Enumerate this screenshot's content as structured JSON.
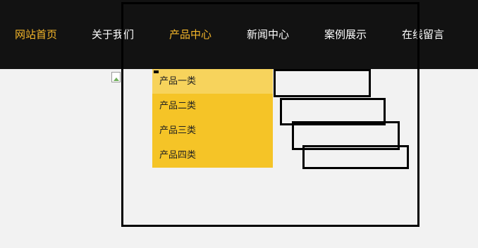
{
  "nav": {
    "items": [
      {
        "label": "网站首页",
        "active": true
      },
      {
        "label": "关于我们",
        "active": false
      },
      {
        "label": "产品中心",
        "active": true
      },
      {
        "label": "新闻中心",
        "active": false
      },
      {
        "label": "案例展示",
        "active": false
      },
      {
        "label": "在线留言",
        "active": false
      }
    ]
  },
  "dropdown": {
    "items": [
      {
        "label": "产品一类"
      },
      {
        "label": "产品二类"
      },
      {
        "label": "产品三类"
      },
      {
        "label": "产品四类"
      }
    ]
  },
  "colors": {
    "navbar_bg": "#121212",
    "nav_text": "#ffffff",
    "nav_active": "#f5b72a",
    "dropdown_bg": "#f5c427",
    "dropdown_hover": "#f7d35c",
    "page_bg": "#f2f2f2"
  },
  "icons": {
    "broken_image": "broken-image-icon"
  }
}
